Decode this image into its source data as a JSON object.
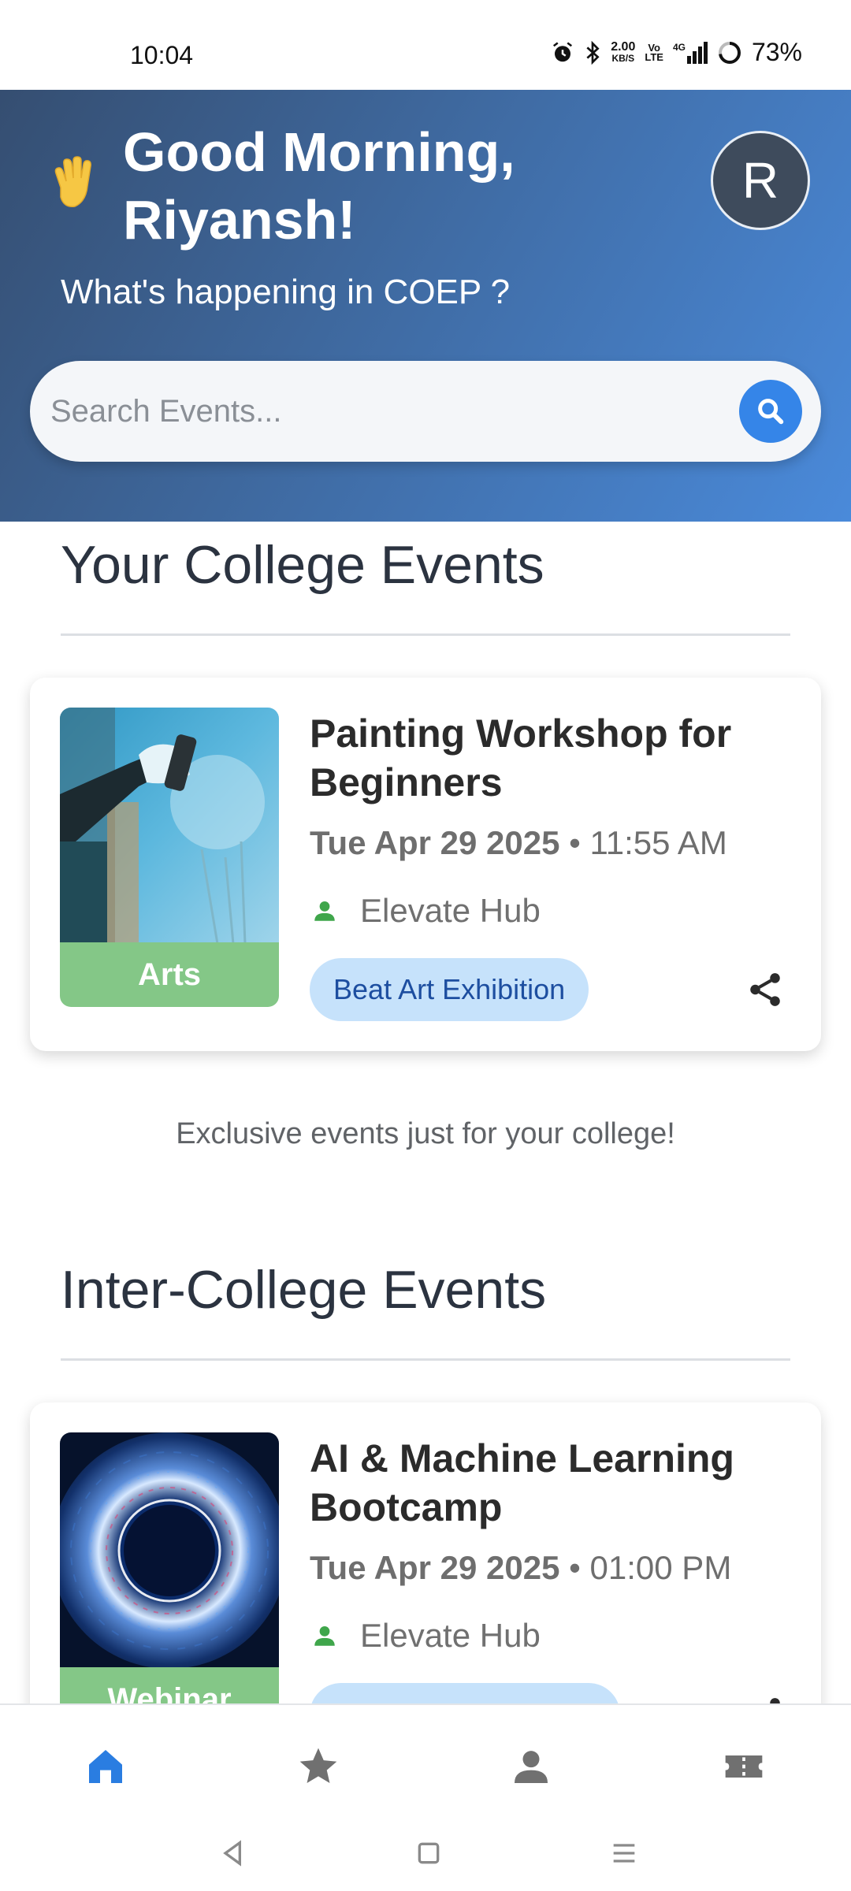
{
  "status_bar": {
    "time": "10:04",
    "net_speed_top": "2.00",
    "net_speed_bottom": "KB/S",
    "vo_top": "Vo",
    "vo_bottom": "LTE",
    "signal_label": "4G",
    "battery": "73%"
  },
  "header": {
    "wave_icon": "waving-hand-icon",
    "greeting": "Good Morning, Riyansh!",
    "subtitle": "What's happening in COEP ?",
    "avatar_letter": "R",
    "colors": {
      "gradient_start": "#354e71",
      "gradient_end": "#4a8ada"
    }
  },
  "search": {
    "placeholder": "Search Events...",
    "icon": "search-icon",
    "button_color": "#3585e8"
  },
  "sections": [
    {
      "title": "Your College Events",
      "events": [
        {
          "title": "Painting Workshop for Beginners",
          "date": "Tue Apr 29 2025",
          "time": "11:55 AM",
          "host": "Elevate Hub",
          "category": "Arts",
          "chip": "Beat Art Exhibition",
          "image": "painting-graffiti-image"
        }
      ],
      "note": "Exclusive events just for your college!"
    },
    {
      "title": "Inter-College Events",
      "events": [
        {
          "title": "AI & Machine Learning Bootcamp",
          "date": "Tue Apr 29 2025",
          "time": "01:00 PM",
          "host": "Elevate Hub",
          "category": "Webinar",
          "image": "ai-circuit-eye-image"
        }
      ]
    }
  ],
  "bottom_nav": {
    "items": [
      {
        "name": "home",
        "icon": "home-icon",
        "active": true
      },
      {
        "name": "favorites",
        "icon": "star-icon",
        "active": false
      },
      {
        "name": "profile",
        "icon": "person-icon",
        "active": false
      },
      {
        "name": "tickets",
        "icon": "ticket-icon",
        "active": false
      }
    ],
    "active_color": "#2a7de1",
    "inactive_color": "#707070"
  },
  "system_nav": [
    "back-icon",
    "home-square-icon",
    "menu-icon"
  ]
}
